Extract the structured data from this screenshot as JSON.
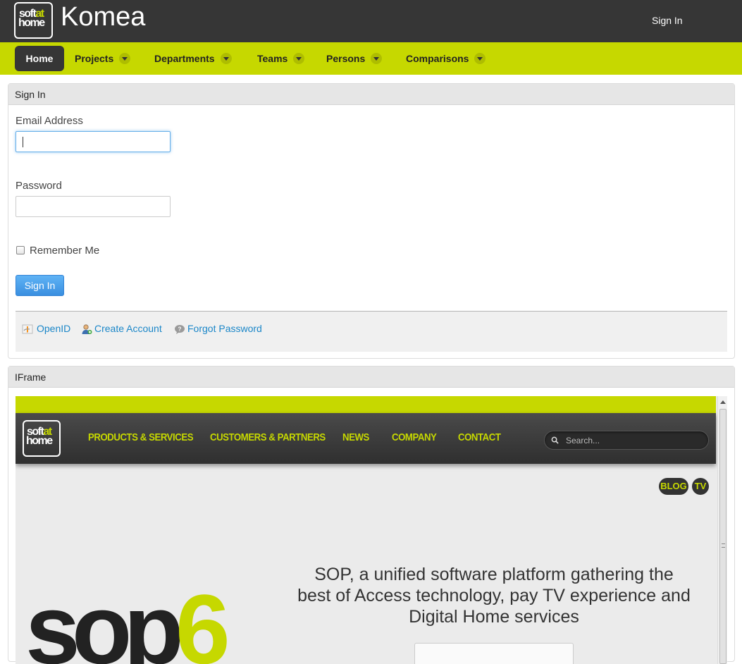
{
  "header": {
    "logo_line1_a": "soft",
    "logo_line1_b": "at",
    "logo_line2": "home",
    "app_title": "Komea",
    "sign_in_link": "Sign In"
  },
  "nav": {
    "items": [
      {
        "label": "Home",
        "active": true
      },
      {
        "label": "Projects",
        "dropdown": true
      },
      {
        "label": "Departments",
        "dropdown": true
      },
      {
        "label": "Teams",
        "dropdown": true
      },
      {
        "label": "Persons",
        "dropdown": true
      },
      {
        "label": "Comparisons",
        "dropdown": true
      }
    ]
  },
  "signin_panel": {
    "title": "Sign In",
    "email_label": "Email Address",
    "email_value": "",
    "password_label": "Password",
    "password_value": "",
    "remember_label": "Remember Me",
    "remember_checked": false,
    "submit_label": "Sign In",
    "links": {
      "openid": "OpenID",
      "create_account": "Create Account",
      "forgot_password": "Forgot Password"
    }
  },
  "iframe_panel": {
    "title": "IFrame",
    "site": {
      "logo_line1_a": "soft",
      "logo_line1_b": "at",
      "logo_line2": "home",
      "nav": [
        "PRODUCTS & SERVICES",
        "CUSTOMERS & PARTNERS",
        "NEWS",
        "COMPANY",
        "CONTACT"
      ],
      "search_placeholder": "Search...",
      "pill_blog": "BLOG",
      "pill_tv": "TV",
      "hero_text": "SOP, a unified software platform gathering the best of Access technology, pay TV experience and Digital Home services",
      "hero_word_a": "sop",
      "hero_word_b": "6"
    }
  },
  "colors": {
    "header_bg": "#363636",
    "nav_bg": "#c6d800",
    "accent_link": "#1a86c8",
    "button_blue": "#3a8fe0"
  }
}
